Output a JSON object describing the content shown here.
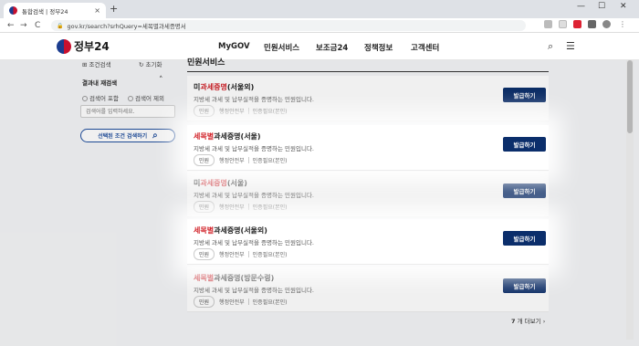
{
  "browser": {
    "tab_title": "통합검색 | 정부24",
    "tab_close": "×",
    "new_tab": "+",
    "back": "←",
    "forward": "→",
    "reload": "C",
    "url": "gov.kr/search?srhQuery=세목별과세증명서",
    "win_min": "—",
    "win_max": "☐",
    "win_close": "✕"
  },
  "header": {
    "logo_text": "정부24",
    "nav": [
      "MyGOV",
      "민원서비스",
      "보조금24",
      "정책정보",
      "고객센터"
    ],
    "search_icon": "⌕",
    "menu_icon": "☰"
  },
  "filter": {
    "condition_label": "조건검색",
    "reset_label": "초기화",
    "section_label": "결과내 재검색",
    "collapse_icon": "˄",
    "option_include": "검색어 포함",
    "option_exclude": "검색어 제외",
    "input_placeholder": "검색어를 입력하세요.",
    "search_button": "선택된 조건 검색하기",
    "search_button_icon": "⌕"
  },
  "main": {
    "section_title": "민원서비스",
    "cards": [
      {
        "title_pre": "미",
        "title_red": "과세증명",
        "title_post": "(서울외)",
        "desc": "지방세 과세 및 납부실적을 증명하는 민원입니다.",
        "badge": "민원",
        "org": "행정안전부",
        "auth": "인증필요(본인)",
        "button": "발급하기"
      },
      {
        "title_pre": "",
        "title_red": "세목별",
        "title_post": "과세증명(서울)",
        "desc": "지방세 과세 및 납부실적을 증명하는 민원입니다.",
        "badge": "민원",
        "org": "행정안전부",
        "auth": "인증필요(본인)",
        "button": "발급하기"
      },
      {
        "title_pre": "미",
        "title_red": "과세증명",
        "title_post": "(서울)",
        "desc": "지방세 과세 및 납부실적을 증명하는 민원입니다.",
        "badge": "민원",
        "org": "행정안전부",
        "auth": "인증필요(본인)",
        "button": "발급하기"
      },
      {
        "title_pre": "",
        "title_red": "세목별",
        "title_post": "과세증명(서울외)",
        "desc": "지방세 과세 및 납부실적을 증명하는 민원입니다.",
        "badge": "민원",
        "org": "행정안전부",
        "auth": "인증필요(본인)",
        "button": "발급하기"
      },
      {
        "title_pre": "",
        "title_red": "세목별",
        "title_post": "과세증명(방문수령)",
        "desc": "지방세 과세 및 납부실적을 증명하는 민원입니다.",
        "badge": "민원",
        "org": "행정안전부",
        "auth": "인증필요(본인)",
        "button": "발급하기"
      }
    ],
    "more_count": "7",
    "more_label": "개 더보기",
    "more_icon": "›"
  },
  "colors": {
    "accent_navy": "#0b2e6b",
    "highlight_red": "#d2232a",
    "link_blue": "#1f4e9e"
  }
}
